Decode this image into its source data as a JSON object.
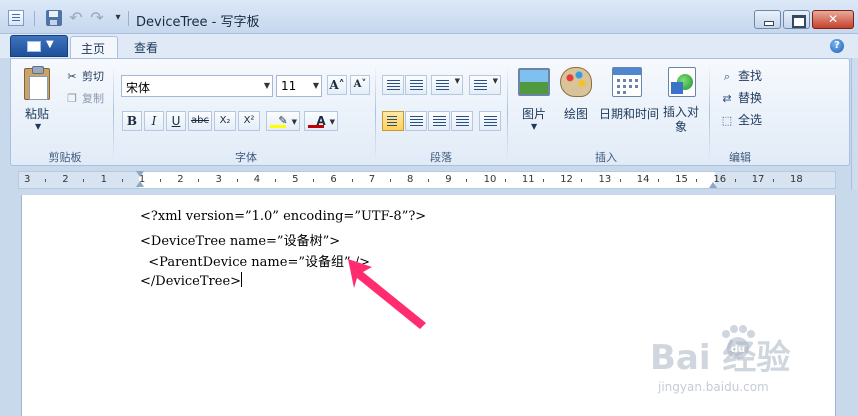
{
  "window": {
    "title": "DeviceTree - 写字板",
    "qa_dropdown": "▾"
  },
  "tabs": [
    {
      "label": "主页"
    },
    {
      "label": "查看"
    }
  ],
  "help_label": "?",
  "app_menu_arrow": "▼",
  "ribbon": {
    "clipboard": {
      "paste": "粘贴",
      "cut": "剪切",
      "copy": "复制",
      "label": "剪贴板"
    },
    "font": {
      "name": "宋体",
      "size": "11",
      "bold": "B",
      "italic": "I",
      "underline": "U",
      "strike": "abc",
      "sub": "X₂",
      "sup": "X²",
      "grow": "A˄",
      "shrink": "A˅",
      "color_glyph": "A",
      "label": "字体"
    },
    "paragraph": {
      "label": "段落"
    },
    "insert": {
      "picture": "图片",
      "paint": "绘图",
      "datetime": "日期和时间",
      "object": "插入对象",
      "label": "插入"
    },
    "edit": {
      "find": "查找",
      "replace": "替换",
      "select_all": "全选",
      "label": "编辑"
    }
  },
  "ruler_numbers": [
    "3",
    "2",
    "1",
    "1",
    "2",
    "3",
    "4",
    "5",
    "6",
    "7",
    "8",
    "9",
    "10",
    "11",
    "12",
    "13",
    "14",
    "15",
    "16",
    "17",
    "18"
  ],
  "document": {
    "lines": [
      "<?xml version=”1.0” encoding=”UTF-8”?>",
      "<DeviceTree name=”设备树”>",
      "  <ParentDevice name=”设备组” />",
      "</DeviceTree>"
    ]
  },
  "watermark": {
    "logo": "Bai  经验",
    "url": "jingyan.baidu.com"
  },
  "colors": {
    "accent": "#1f4f99",
    "annotation_arrow": "#ff2d6f"
  }
}
